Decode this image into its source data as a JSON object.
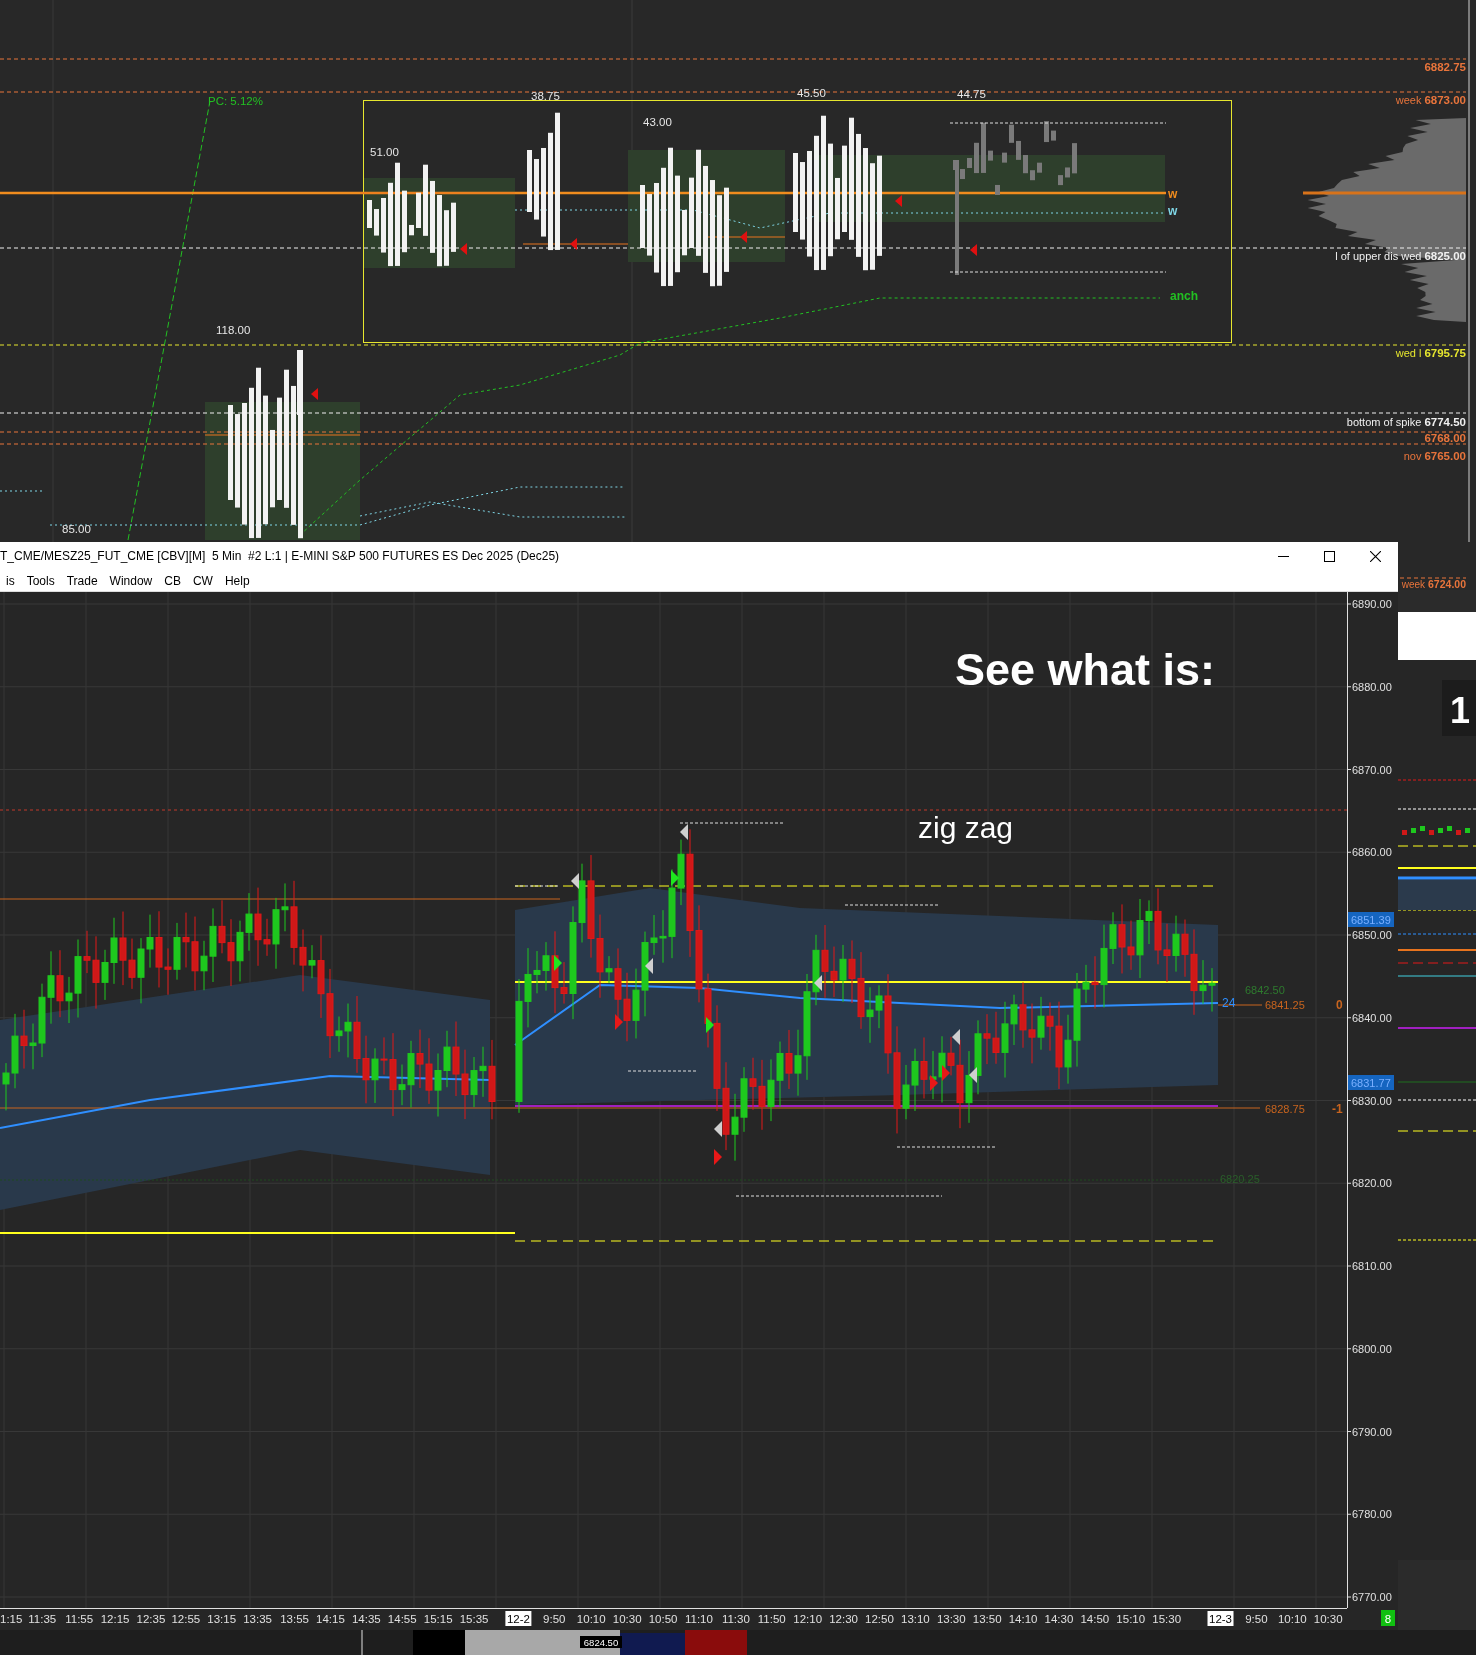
{
  "top_chart": {
    "levels": [
      {
        "price": "6882.75",
        "color": "#e8743b"
      },
      {
        "label": "week",
        "price": "6873.00",
        "color": "#e8743b"
      },
      {
        "label": "l of upper dis wed",
        "price": "6825.00",
        "color": "#f0f0f0"
      },
      {
        "label": "wed l",
        "price": "6795.75",
        "color": "#e6e62e"
      },
      {
        "label": "bottom of spike",
        "price": "6774.50",
        "color": "#f0f0f0"
      },
      {
        "price": "6768.00",
        "color": "#e8743b"
      },
      {
        "label": "nov",
        "price": "6765.00",
        "color": "#e8743b"
      },
      {
        "label": "week",
        "price": "6724.00",
        "color": "#e8743b"
      }
    ],
    "annotations": [
      "PC: 5.12%",
      "38.75",
      "45.50",
      "44.75",
      "51.00",
      "43.00",
      "118.00",
      "85.00"
    ],
    "line_tags": [
      {
        "text": "w",
        "color": "#f08c1e"
      },
      {
        "text": "w",
        "color": "#7fd6e6"
      },
      {
        "text": "anch",
        "color": "#22c022"
      }
    ]
  },
  "window": {
    "title": "T_CME/MESZ25_FUT_CME [CBV][M]  5 Min  #2 L:1 | E-MINI S&P 500 FUTURES ES Dec 2025 (Dec25)",
    "menu": [
      "is",
      "Tools",
      "Trade",
      "Window",
      "CB",
      "CW",
      "Help"
    ]
  },
  "chart": {
    "headline": "See what is:",
    "note": "zig zag",
    "price_ticks": [
      "6890.00",
      "6880.00",
      "6870.00",
      "6860.00",
      "6850.00",
      "6840.00",
      "6830.00",
      "6820.00",
      "6810.00",
      "6800.00",
      "6790.00",
      "6780.00",
      "6770.00"
    ],
    "price_tags": [
      "6851.39",
      "6831.77"
    ],
    "line_labels": [
      {
        "text": "24",
        "color": "#2f8fff"
      },
      {
        "text": "6841.25",
        "color": "#c8641e"
      },
      {
        "text": "0",
        "color": "#c8641e"
      },
      {
        "text": "6842.50",
        "color": "#2e7a2e"
      },
      {
        "text": "6828.75",
        "color": "#c8641e"
      },
      {
        "text": "-1",
        "color": "#c8641e"
      },
      {
        "text": "6820.25",
        "color": "#2a5e2a"
      }
    ],
    "time_labels": [
      {
        "text": "1:15",
        "kind": "time"
      },
      {
        "text": "11:35",
        "kind": "time"
      },
      {
        "text": "11:55",
        "kind": "time"
      },
      {
        "text": "12:15",
        "kind": "time"
      },
      {
        "text": "12:35",
        "kind": "time"
      },
      {
        "text": "12:55",
        "kind": "time"
      },
      {
        "text": "13:15",
        "kind": "time"
      },
      {
        "text": "13:35",
        "kind": "time"
      },
      {
        "text": "13:55",
        "kind": "time"
      },
      {
        "text": "14:15",
        "kind": "time"
      },
      {
        "text": "14:35",
        "kind": "time"
      },
      {
        "text": "14:55",
        "kind": "time"
      },
      {
        "text": "15:15",
        "kind": "time"
      },
      {
        "text": "15:35",
        "kind": "time"
      },
      {
        "text": "12-2",
        "kind": "date"
      },
      {
        "text": "9:50",
        "kind": "time"
      },
      {
        "text": "10:10",
        "kind": "time"
      },
      {
        "text": "10:30",
        "kind": "time"
      },
      {
        "text": "10:50",
        "kind": "time"
      },
      {
        "text": "11:10",
        "kind": "time"
      },
      {
        "text": "11:30",
        "kind": "time"
      },
      {
        "text": "11:50",
        "kind": "time"
      },
      {
        "text": "12:10",
        "kind": "time"
      },
      {
        "text": "12:30",
        "kind": "time"
      },
      {
        "text": "12:50",
        "kind": "time"
      },
      {
        "text": "13:10",
        "kind": "time"
      },
      {
        "text": "13:30",
        "kind": "time"
      },
      {
        "text": "13:50",
        "kind": "time"
      },
      {
        "text": "14:10",
        "kind": "time"
      },
      {
        "text": "14:30",
        "kind": "time"
      },
      {
        "text": "14:50",
        "kind": "time"
      },
      {
        "text": "15:10",
        "kind": "time"
      },
      {
        "text": "15:30",
        "kind": "time"
      },
      {
        "text": "12-3",
        "kind": "date"
      },
      {
        "text": "9:50",
        "kind": "time"
      },
      {
        "text": "10:10",
        "kind": "time"
      },
      {
        "text": "10:30",
        "kind": "time"
      }
    ],
    "badge": "8"
  },
  "side_panel": {
    "number": "1"
  },
  "order_book": {
    "price": "6824.50"
  }
}
